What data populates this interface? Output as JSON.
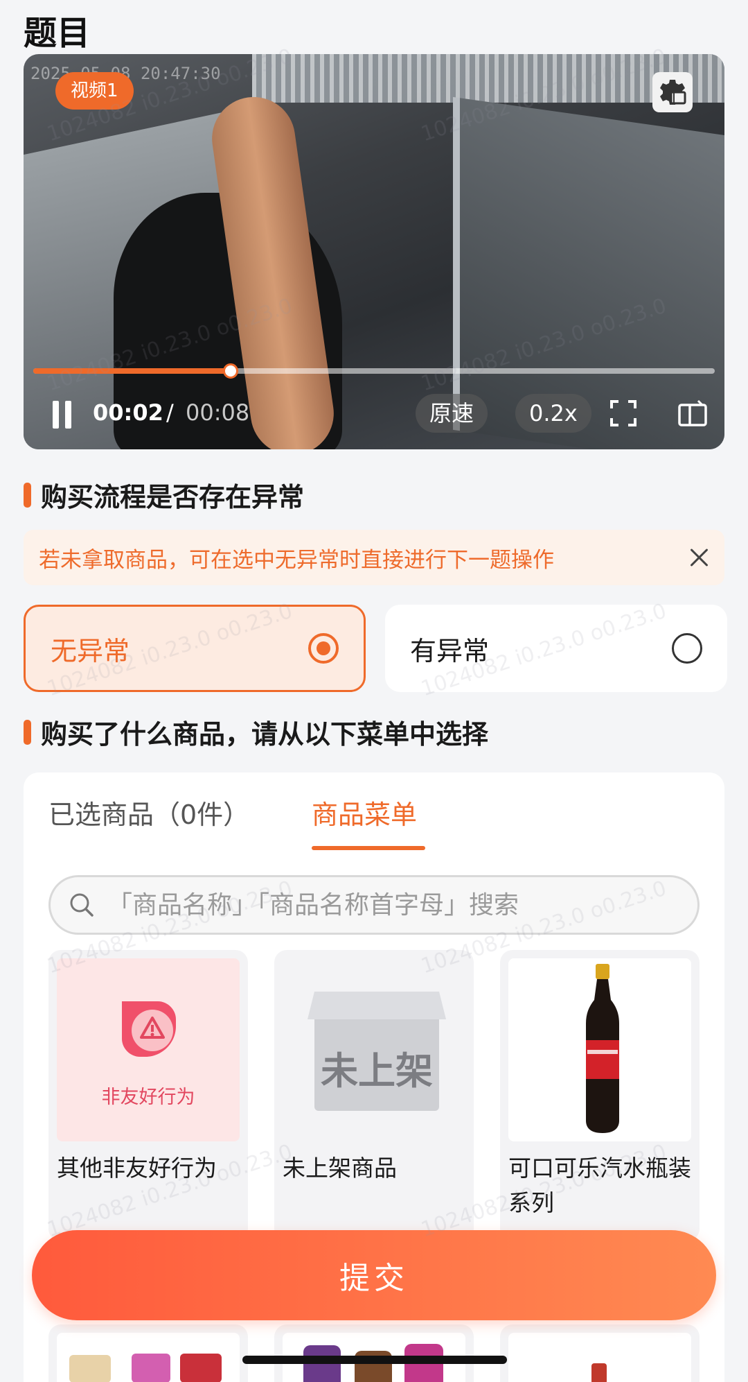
{
  "page": {
    "title": "题目"
  },
  "video": {
    "timestamp": "2025-05-08 20:47:30",
    "badge": "视频1",
    "current_time": "00:02",
    "separator": "/",
    "total_time": "00:08",
    "progress": 0.29,
    "speed_original_label": "原速",
    "speed_label": "0.2x",
    "accent_color": "#ef6a2a"
  },
  "question1": {
    "title": "购买流程是否存在异常",
    "notice": "若未拿取商品，可在选中无异常时直接进行下一题操作",
    "options": [
      {
        "label": "无异常",
        "selected": true
      },
      {
        "label": "有异常",
        "selected": false
      }
    ]
  },
  "question2": {
    "title": "购买了什么商品，请从以下菜单中选择",
    "tabs": [
      {
        "label": "已选商品（0件）",
        "active": false
      },
      {
        "label": "商品菜单",
        "active": true
      }
    ],
    "search_placeholder": "「商品名称」「商品名称首字母」搜索",
    "products": [
      {
        "name": "其他非友好行为",
        "image_label": "非友好行为",
        "icon": "warning-icon"
      },
      {
        "name": "未上架商品",
        "image_label": "未上架",
        "icon": "box-icon"
      },
      {
        "name": "可口可乐汽水瓶装系列",
        "icon": "cola-bottle-icon"
      }
    ]
  },
  "submit_label": "提交",
  "watermark": "1024082 i0.23.0 o0.23.0"
}
